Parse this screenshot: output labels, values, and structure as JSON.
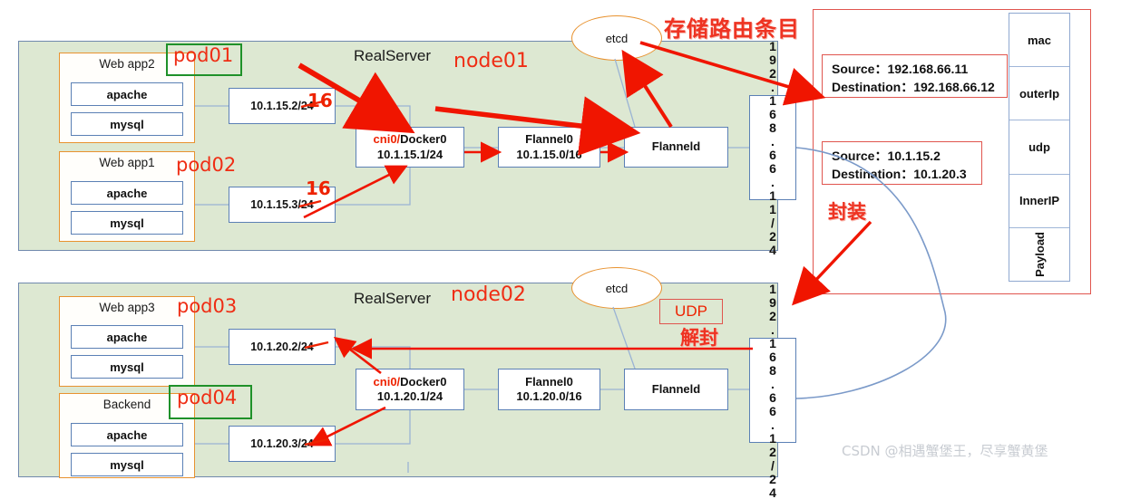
{
  "nodes": [
    {
      "id": "node01",
      "realserver_label": "RealServer",
      "node_label": "node01",
      "pods": [
        {
          "title": "Web app2",
          "label": "pod01",
          "highlighted": true,
          "containers": [
            "apache",
            "mysql"
          ],
          "ip": "10.1.15.2/24",
          "ip_override": "16"
        },
        {
          "title": "Web app1",
          "label": "pod02",
          "highlighted": false,
          "containers": [
            "apache",
            "mysql"
          ],
          "ip": "10.1.15.3/24",
          "ip_override": "16"
        }
      ],
      "bridge": {
        "prefix": "cni0/",
        "name": "Docker0",
        "cidr": "10.1.15.1/24"
      },
      "flannel0": {
        "name": "Flannel0",
        "cidr": "10.1.15.0/16"
      },
      "flanneld": {
        "name": "Flanneld"
      },
      "host_ip": "192.168.66.11/24",
      "etcd": "etcd"
    },
    {
      "id": "node02",
      "realserver_label": "RealServer",
      "node_label": "node02",
      "pods": [
        {
          "title": "Web app3",
          "label": "pod03",
          "highlighted": false,
          "containers": [
            "apache",
            "mysql"
          ],
          "ip": "10.1.20.2/24",
          "ip_override": ""
        },
        {
          "title": "Backend",
          "label": "pod04",
          "highlighted": true,
          "containers": [
            "apache",
            "mysql"
          ],
          "ip": "10.1.20.3/24",
          "ip_override": ""
        }
      ],
      "bridge": {
        "prefix": "cni0/",
        "name": "Docker0",
        "cidr": "10.1.20.1/24"
      },
      "flannel0": {
        "name": "Flannel0",
        "cidr": "10.1.20.0/16"
      },
      "flanneld": {
        "name": "Flanneld"
      },
      "host_ip": "192.168.66.12/24",
      "etcd": "etcd"
    }
  ],
  "annotations": {
    "etcd_note": "存储路由条目",
    "encapsulate_note": "封装",
    "decapsulate_note": "解封",
    "udp_label": "UDP"
  },
  "packet_panel": {
    "outer": {
      "source_label": "Source：",
      "source_value": "192.168.66.11",
      "dest_label": "Destination：",
      "dest_value": "192.168.66.12"
    },
    "inner": {
      "source_label": "Source：",
      "source_value": "10.1.15.2",
      "dest_label": "Destination：",
      "dest_value": "10.1.20.3"
    },
    "stack": [
      "mac",
      "outerIp",
      "udp",
      "InnerIP",
      "Payload"
    ]
  },
  "watermark": "CSDN @相遇蟹堡王，尽享蟹黄堡",
  "colors": {
    "node_fill": "#dde8d2",
    "node_border": "#7089ad",
    "pod_border": "#e8922f",
    "box_border": "#5b80b5",
    "accent_red": "#ee2200",
    "highlight_green": "#1f9129",
    "panel_red": "#e0554e",
    "curve_blue": "#7b9ac9"
  }
}
